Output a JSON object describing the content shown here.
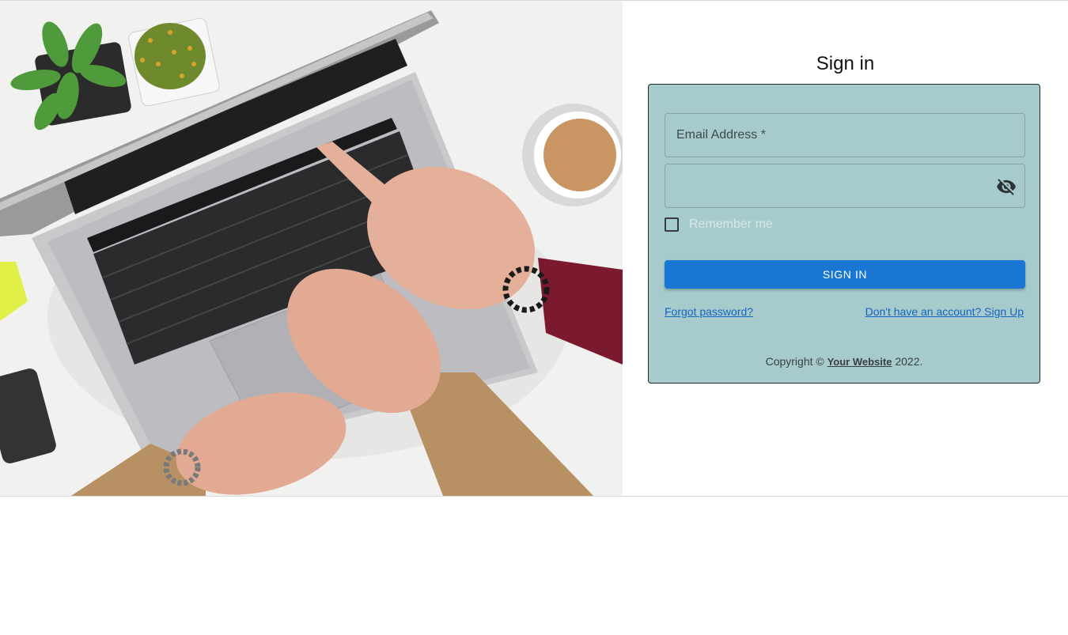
{
  "signin": {
    "title": "Sign in",
    "email_placeholder": "Email Address *",
    "password_placeholder": "",
    "password_toggle_icon": "visibility-off-icon",
    "remember_label": "Remember me",
    "button_label": "Sign In",
    "forgot_link": "Forgot password?",
    "signup_link": "Don't have an account? Sign Up"
  },
  "footer": {
    "copyright_prefix": "Copyright ©",
    "site_link": "Your Website",
    "year": "2022."
  },
  "hero": {
    "description_icon": "laptop-typing-photo"
  },
  "colors": {
    "card_background": "#a7cbcc",
    "primary_button": "#1976d2",
    "link": "#1565c0"
  }
}
